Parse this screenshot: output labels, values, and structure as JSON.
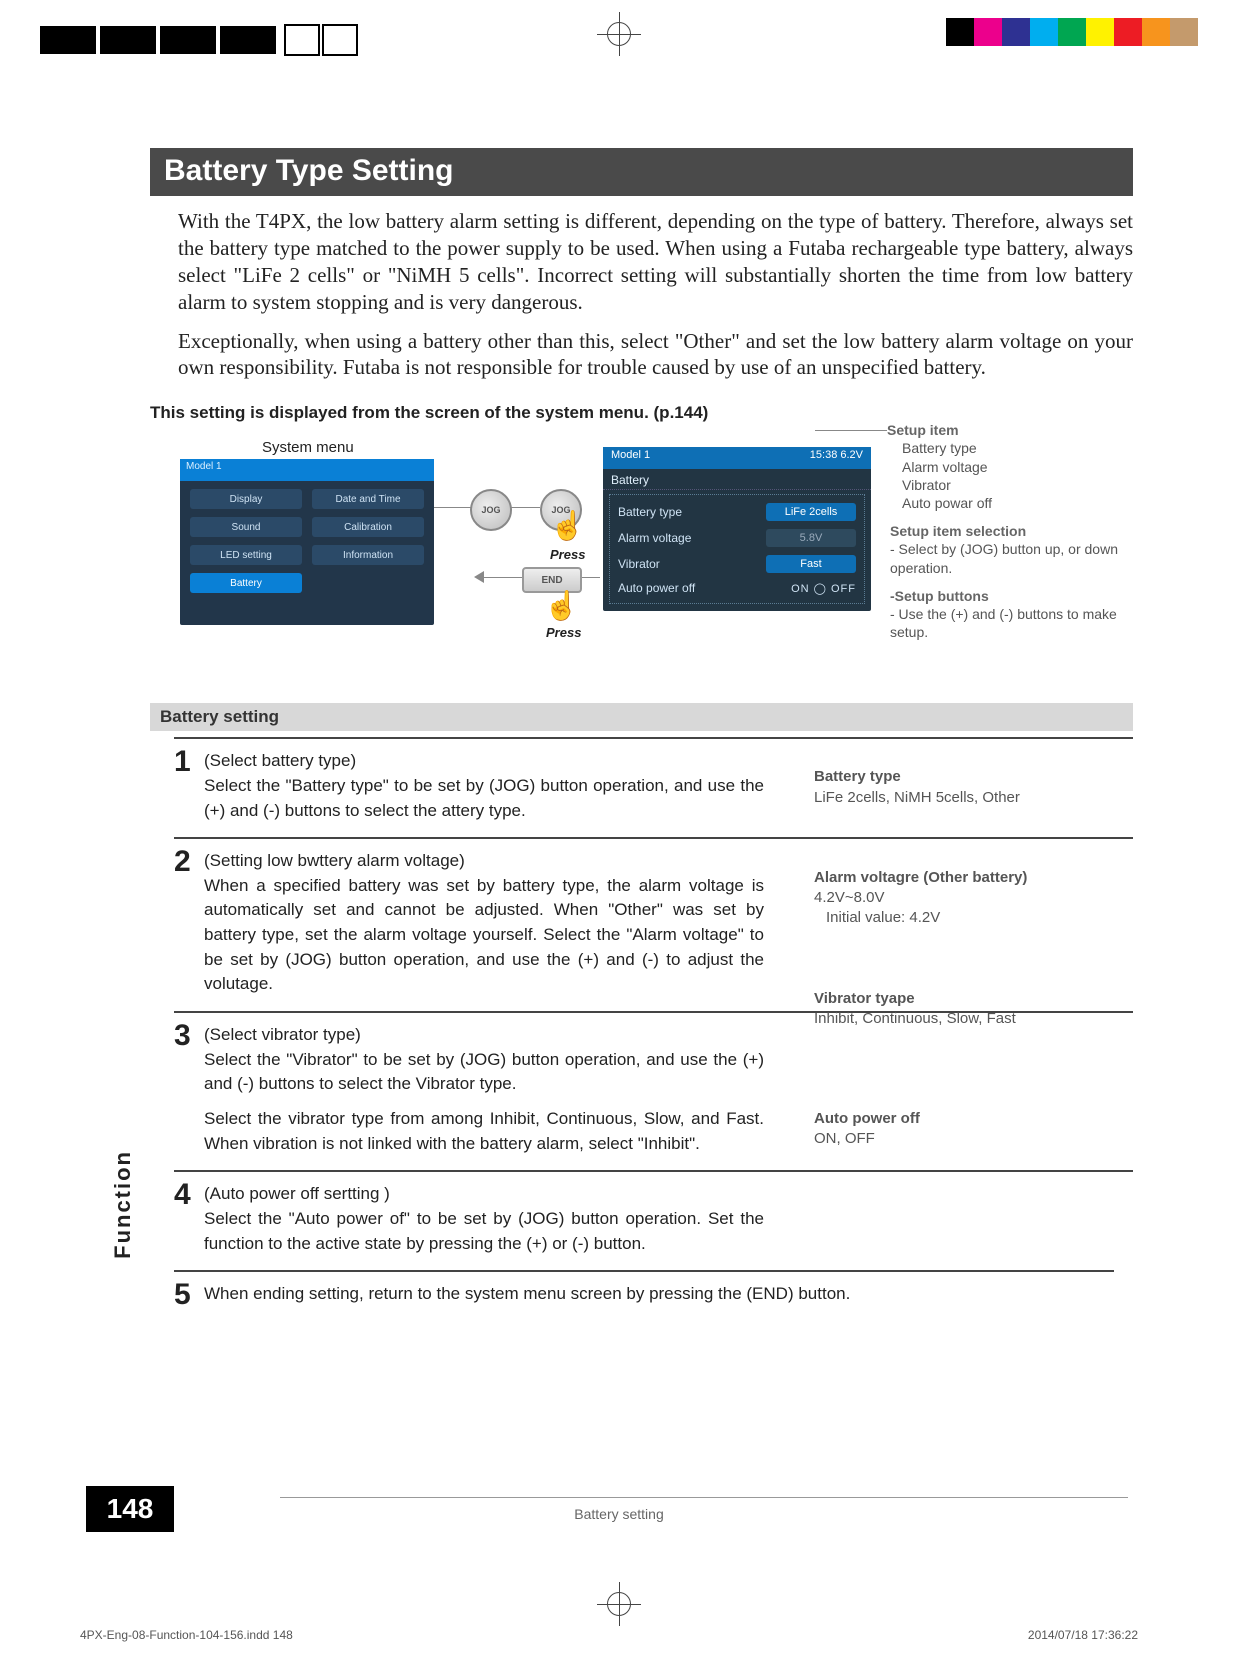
{
  "title": "Battery Type Setting",
  "intro_p1": "With the T4PX, the low battery alarm setting is different, depending on the type of battery. Therefore, always set the battery type matched to the power supply to be used. When using a Futaba rechargeable type battery, always select \"LiFe 2 cells\" or \"NiMH 5 cells\". Incorrect setting will substantially shorten the time from low battery alarm to system stopping and is very dangerous.",
  "intro_p2": "Exceptionally, when using a battery other than this, select \"Other\" and set the low battery alarm voltage on your own responsibility. Futaba is not responsible for trouble caused by use of an unspecified battery.",
  "display_note": "This setting is displayed from the screen of the system menu. (p.144)",
  "sysmenu_label": "System menu",
  "sysmenu_header": "Model 1",
  "sysmenu_cells": {
    "r1a": "Display",
    "r1b": "Date and Time",
    "r2a": "Sound",
    "r2b": "Calibration",
    "r3a": "LED setting",
    "r3b": "Information",
    "r4a": "Battery",
    "r4b": ""
  },
  "battery_screen": {
    "model": "Model 1",
    "clock": "15:38 6.2V",
    "section": "Battery",
    "rows": {
      "battery_type_label": "Battery type",
      "battery_type_value": "LiFe 2cells",
      "alarm_voltage_label": "Alarm voltage",
      "alarm_voltage_value": "5.8V",
      "vibrator_label": "Vibrator",
      "vibrator_value": "Fast",
      "auto_off_label": "Auto power off",
      "auto_off_value": "ON ◯ OFF"
    }
  },
  "jog_label": "JOG",
  "end_label": "END",
  "press_label": "Press",
  "setup_info": {
    "setup_item_head": "Setup item",
    "items": {
      "a": "Battery type",
      "b": "Alarm voltage",
      "c": "Vibrator",
      "d": "Auto powar off"
    },
    "selection_head": "Setup item selection",
    "selection_text": "- Select by (JOG) button up, or down operation.",
    "buttons_head": "-Setup buttons",
    "buttons_text": "- Use the (+) and (-) buttons to make setup."
  },
  "setting_header": "Battery setting",
  "steps": {
    "s1_title": "(Select battery type)",
    "s1_text": "Select the \"Battery type\" to be set by (JOG) button operation, and use the (+) and (-) buttons to select the attery type.",
    "s2_title": "(Setting low bwttery alarm voltage)",
    "s2_text": "When a specified battery was set by battery type, the alarm voltage is automatically set and cannot be adjusted. When \"Other\" was set by battery type, set the alarm voltage yourself. Select the \"Alarm voltage\" to be set by (JOG) button operation, and use the (+) and (-) to adjust the volutage.",
    "s3_title": "(Select vibrator type)",
    "s3_text1": "Select the \"Vibrator\" to be set by (JOG) button operation, and use the (+) and (-) buttons to select the Vibrator type.",
    "s3_text2": "Select the vibrator type from among Inhibit, Continuous, Slow, and Fast. When vibration is not linked with the battery alarm, select \"Inhibit\".",
    "s4_title": "(Auto power off sertting )",
    "s4_text": "Select the \"Auto power of\" to be set by (JOG) button operation. Set the function to the active state by pressing the (+) or (-) button.",
    "s5_text": "When ending setting, return to the system menu screen by pressing the (END) button."
  },
  "side": {
    "bt_head": "Battery type",
    "bt_text": "LiFe 2cells, NiMH 5cells, Other",
    "av_head": "Alarm voltagre (Other battery)",
    "av_text1": "4.2V~8.0V",
    "av_text2": "Initial value: 4.2V",
    "vb_head": "Vibrator tyape",
    "vb_text": "Inhibit, Continuous, Slow, Fast",
    "ap_head": "Auto power off",
    "ap_text": "ON, OFF"
  },
  "vert_label": "Function",
  "page_number": "148",
  "footer_title": "Battery setting",
  "print_footer_left": "4PX-Eng-08-Function-104-156.indd   148",
  "print_footer_right": "2014/07/18   17:36:22",
  "swatches": [
    "#000000",
    "#ec008c",
    "#2e3192",
    "#00aeef",
    "#00a651",
    "#fff200",
    "#ed1c24",
    "#f7941d",
    "#c49a6c"
  ]
}
